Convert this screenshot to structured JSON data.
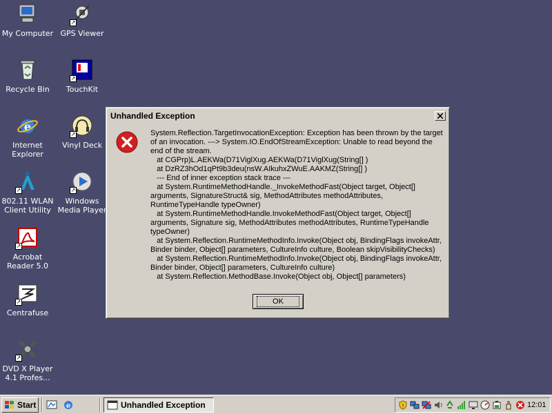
{
  "desktop": {
    "icons": [
      {
        "label": "My Computer",
        "icon": "computer-icon"
      },
      {
        "label": "GPS Viewer",
        "icon": "satellite-icon"
      },
      {
        "label": "Recycle Bin",
        "icon": "recycle-bin-icon"
      },
      {
        "label": "TouchKit",
        "icon": "touchkit-icon"
      },
      {
        "label": "Internet Explorer",
        "icon": "internet-explorer-icon"
      },
      {
        "label": "Vinyl Deck",
        "icon": "headphones-icon"
      },
      {
        "label": "802.11 WLAN Client Utility",
        "icon": "wlan-icon"
      },
      {
        "label": "Windows Media Player",
        "icon": "media-player-icon"
      },
      {
        "label": "Acrobat Reader 5.0",
        "icon": "acrobat-icon"
      },
      {
        "label": "Centrafuse",
        "icon": "centrafuse-icon"
      },
      {
        "label": "DVD X Player 4.1 Profes...",
        "icon": "dvd-player-icon"
      }
    ]
  },
  "dialog": {
    "title": "Unhandled Exception",
    "icon": "error-icon",
    "message": "System.Reflection.TargetInvocationException: Exception has been thrown by the target of an invocation. ---> System.IO.EndOfStreamException: Unable to read beyond the end of the stream.\n   at CGPrp)L.AEKWa(D71ViglXug.AEKWa(D71ViglXug(String[] )\n   at DzRZ3hOd1qPt9b3deu(nsW.AIkuhxZWuE.AAKMZ(String[] )\n   --- End of inner exception stack trace ---\n   at System.RuntimeMethodHandle._InvokeMethodFast(Object target, Object[] arguments, SignatureStruct& sig, MethodAttributes methodAttributes, RuntimeTypeHandle typeOwner)\n   at System.RuntimeMethodHandle.InvokeMethodFast(Object target, Object[] arguments, Signature sig, MethodAttributes methodAttributes, RuntimeTypeHandle typeOwner)\n   at System.Reflection.RuntimeMethodInfo.Invoke(Object obj, BindingFlags invokeAttr, Binder binder, Object[] parameters, CultureInfo culture, Boolean skipVisibilityChecks)\n   at System.Reflection.RuntimeMethodInfo.Invoke(Object obj, BindingFlags invokeAttr, Binder binder, Object[] parameters, CultureInfo culture)\n   at System.Reflection.MethodBase.Invoke(Object obj, Object[] parameters)",
    "ok_label": "OK",
    "close_label": "×"
  },
  "taskbar": {
    "start_label": "Start",
    "quick_launch": [
      "desktop-icon",
      "internet-explorer-icon"
    ],
    "task_button_label": "Unhandled Exception",
    "tray_icons": [
      "shield-icon",
      "network-icon",
      "network-disconnected-icon",
      "audio-icon",
      "recycle-icon",
      "signal-bars-icon",
      "monitor-icon",
      "gauge-icon",
      "battery-icon",
      "hand-icon",
      "stop-icon"
    ],
    "clock": "12:01"
  },
  "colors": {
    "desktop_background": "#494a6b",
    "dialog_face": "#d4d0c8",
    "error_red": "#d02020"
  }
}
